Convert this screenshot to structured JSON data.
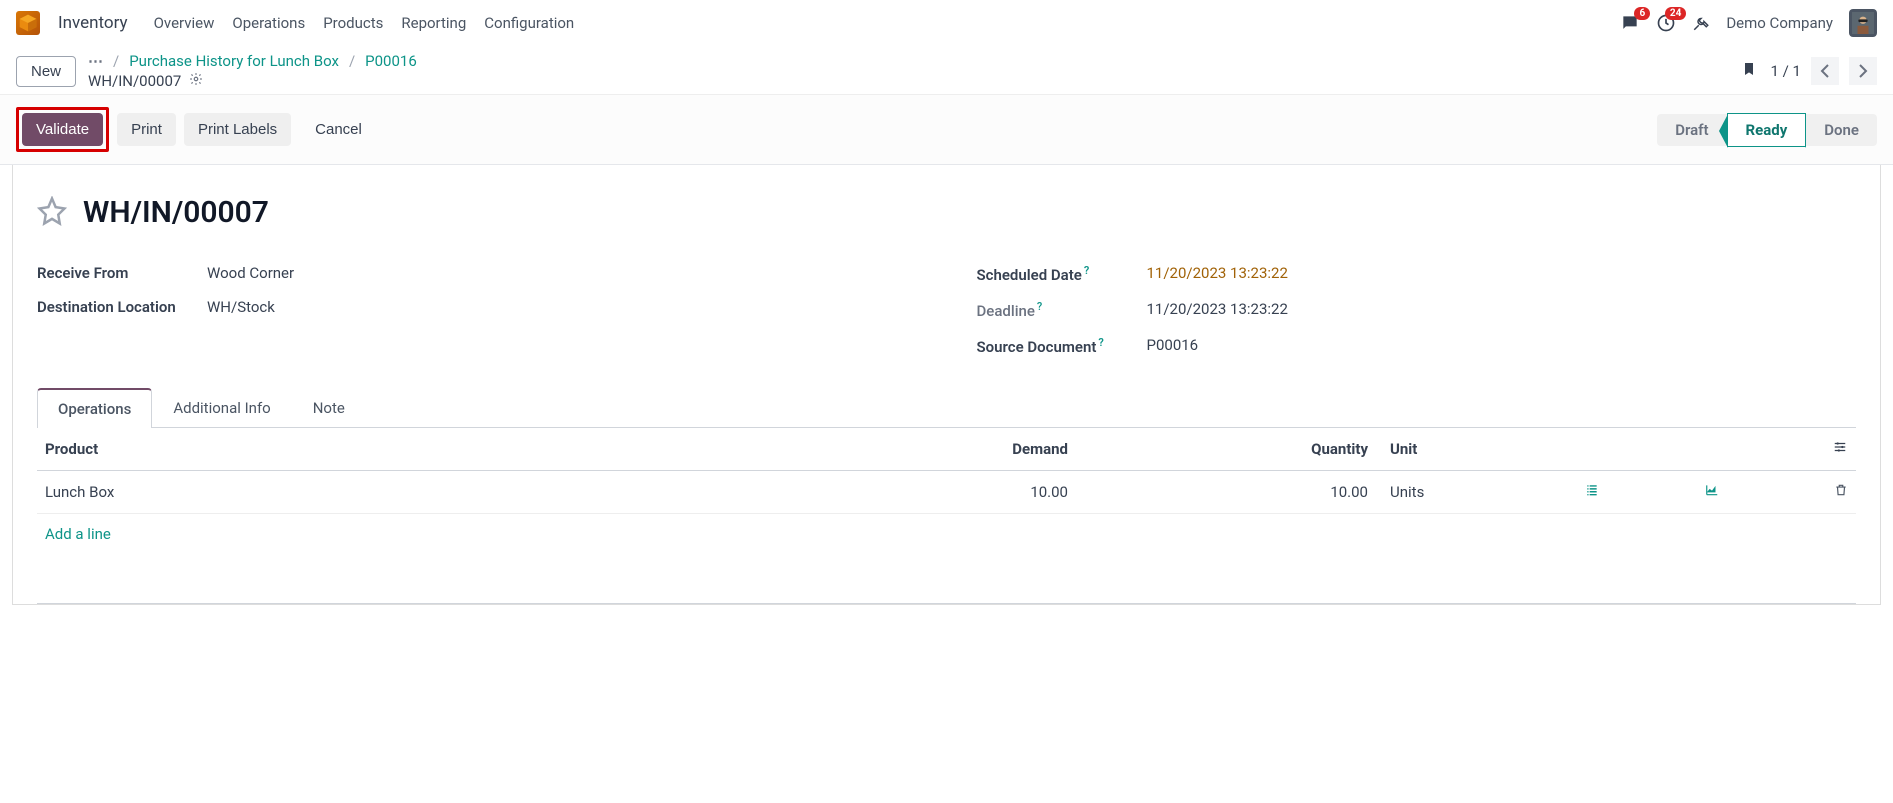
{
  "navbar": {
    "app_name": "Inventory",
    "menu": [
      "Overview",
      "Operations",
      "Products",
      "Reporting",
      "Configuration"
    ],
    "badges": {
      "messages": "6",
      "activities": "24"
    },
    "company": "Demo Company"
  },
  "control": {
    "new_label": "New",
    "breadcrumb": {
      "link1": "Purchase History for Lunch Box",
      "link2": "P00016",
      "current": "WH/IN/00007"
    },
    "pager": "1 / 1"
  },
  "actions": {
    "validate": "Validate",
    "print": "Print",
    "print_labels": "Print Labels",
    "cancel": "Cancel"
  },
  "status": {
    "draft": "Draft",
    "ready": "Ready",
    "done": "Done"
  },
  "record": {
    "title": "WH/IN/00007",
    "fields": {
      "receive_from_label": "Receive From",
      "receive_from": "Wood Corner",
      "dest_label": "Destination Location",
      "dest": "WH/Stock",
      "scheduled_label": "Scheduled Date",
      "scheduled": "11/20/2023 13:23:22",
      "deadline_label": "Deadline",
      "deadline": "11/20/2023 13:23:22",
      "source_doc_label": "Source Document",
      "source_doc": "P00016"
    }
  },
  "tabs": {
    "operations": "Operations",
    "additional": "Additional Info",
    "note": "Note"
  },
  "table": {
    "headers": {
      "product": "Product",
      "demand": "Demand",
      "quantity": "Quantity",
      "unit": "Unit"
    },
    "rows": [
      {
        "product": "Lunch Box",
        "demand": "10.00",
        "quantity": "10.00",
        "unit": "Units"
      }
    ],
    "add_line": "Add a line"
  }
}
